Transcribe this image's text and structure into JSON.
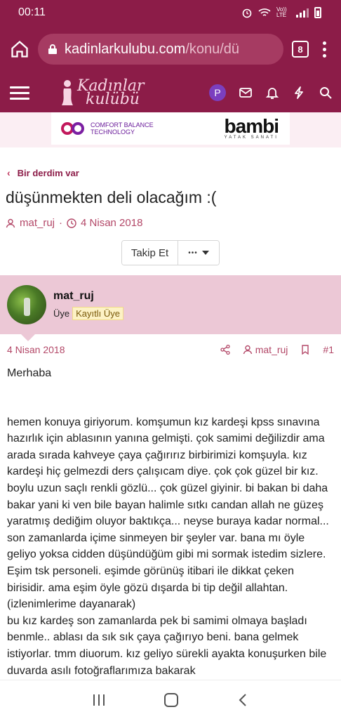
{
  "status_bar": {
    "time": "00:11",
    "network_label": "Vo)) LTE"
  },
  "browser": {
    "url_host": "kadinlarkulubu.com",
    "url_path": "/konu/dü",
    "tab_count": "8"
  },
  "site": {
    "logo_line1": "Kadınlar",
    "logo_line2": "kulübü",
    "user_initial": "P"
  },
  "ad": {
    "left_line1": "COMFORT BALANCE",
    "left_line2": "TECHNOLOGY",
    "brand": "bambi",
    "brand_sub": "YATAK SANATI"
  },
  "breadcrumb": {
    "label": "Bir derdim var"
  },
  "thread": {
    "title": "düşünmekten deli olacağım :(",
    "author": "mat_ruj",
    "separator": "·",
    "date": "4 Nisan 2018",
    "follow_label": "Takip Et",
    "more_label": "•••"
  },
  "post": {
    "username": "mat_ruj",
    "role": "Üye",
    "badge": "Kayıtlı Üye",
    "date": "4 Nisan 2018",
    "author": "mat_ruj",
    "number": "#1",
    "greeting": "Merhaba",
    "paragraph1": "hemen konuya giriyorum. komşumun kız kardeşi kpss sınavına hazırlık için ablasının yanına gelmişti. çok samimi değilizdir ama arada sırada kahveye çaya çağırırız birbirimizi komşuyla. kız kardeşi hiç gelmezdi ders çalışıcam diye. çok çok güzel bir kız. boylu uzun saçlı renkli gözlü... çok güzel giyinir. bi bakan bi daha bakar yani ki ven bile bayan halimle sıtkı candan allah ne güzeş yaratmış dediğim oluyor baktıkça... neyse buraya kadar normal... son zamanlarda içime sinmeyen bir şeyler var. bana mı öyle geliyo yoksa cidden düşündüğüm gibi mi sormak istedim sizlere.",
    "paragraph2": "Eşim tsk personeli. eşimde görünüş itibari ile dikkat çeken birisidir. ama eşim öyle gözü dışarda bi tip değil allahtan. (izlenimlerime dayanarak)",
    "paragraph3": "bu kız kardeş son zamanlarda pek bi samimi olmaya başladı benmle.. ablası da sık sık çaya çağırıyo beni. bana gelmek istiyorlar. tmm diuorum. kız geliyo sürekli ayakta konuşurken bile duvarda asılı fotoğraflarımıza bakarak"
  }
}
